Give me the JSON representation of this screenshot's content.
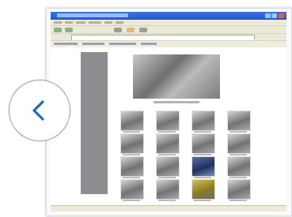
{
  "screenshot": {
    "description_role": "thumbnail-of-browser-window",
    "thumbnail_tiles": 16,
    "tile_variants": [
      "gray",
      "gray",
      "gray",
      "gray",
      "gray",
      "gray",
      "gray",
      "gray",
      "gray",
      "gray",
      "blue",
      "gray",
      "gray",
      "gray",
      "gold",
      "gray"
    ]
  },
  "navigation": {
    "back_icon": "chevron-left-icon",
    "accent_color": "#1f6eb5"
  }
}
